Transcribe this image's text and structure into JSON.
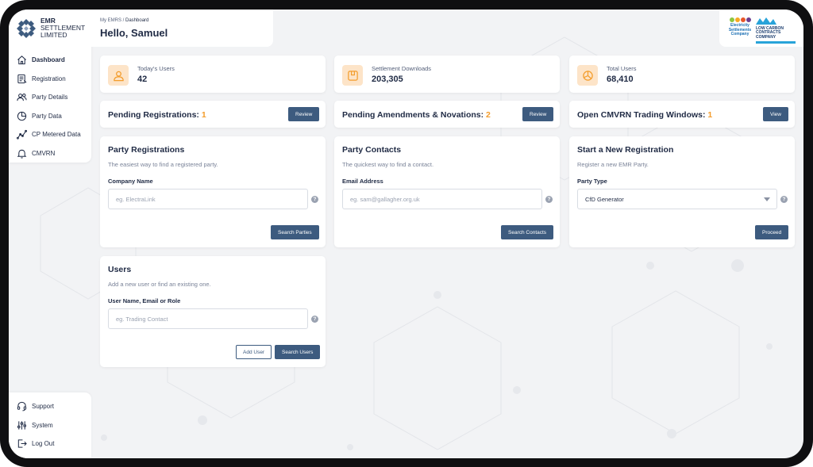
{
  "brand": {
    "line1": "EMR",
    "line2": "SETTLEMENT",
    "line3": "LIMITED"
  },
  "sidebar": {
    "items": [
      {
        "label": "Dashboard",
        "icon": "home-icon"
      },
      {
        "label": "Registration",
        "icon": "form-icon"
      },
      {
        "label": "Party Details",
        "icon": "users-icon"
      },
      {
        "label": "Party Data",
        "icon": "pie-icon"
      },
      {
        "label": "CP Metered Data",
        "icon": "chart-line-icon"
      },
      {
        "label": "CMVRN",
        "icon": "bell-icon"
      }
    ],
    "bottom_items": [
      {
        "label": "Support",
        "icon": "headset-icon"
      },
      {
        "label": "System",
        "icon": "sliders-icon"
      },
      {
        "label": "Log Out",
        "icon": "logout-icon"
      }
    ]
  },
  "header": {
    "crumb_root": "My EMRS",
    "crumb_sep": " / ",
    "crumb_current": "Dashboard",
    "greeting": "Hello, Samuel"
  },
  "partners": {
    "esc": {
      "line1": "Electricity",
      "line2": "Settlements",
      "line3": "Company"
    },
    "lcc": {
      "line1": "LOW CARBON",
      "line2": "CONTRACTS COMPANY"
    }
  },
  "stats": [
    {
      "label": "Today's Users",
      "value": "42"
    },
    {
      "label": "Settlement Downloads",
      "value": "203,305"
    },
    {
      "label": "Total Users",
      "value": "68,410"
    }
  ],
  "pending": [
    {
      "label": "Pending Registrations: ",
      "count": "1",
      "button": "Review"
    },
    {
      "label": "Pending Amendments & Novations: ",
      "count": "2",
      "button": "Review"
    },
    {
      "label": "Open CMVRN Trading Windows: ",
      "count": "1",
      "button": "View"
    }
  ],
  "party_registrations": {
    "title": "Party Registrations",
    "subtitle": "The easiest way to find a registered party.",
    "field_label": "Company Name",
    "placeholder": "eg. ElectraLink",
    "button": "Search Parties"
  },
  "party_contacts": {
    "title": "Party Contacts",
    "subtitle": "The quickest way to find a contact.",
    "field_label": "Email Address",
    "placeholder": "eg. sam@gallagher.org.uk",
    "button": "Search Contacts"
  },
  "new_registration": {
    "title": "Start a New Registration",
    "subtitle": "Register a new EMR Party.",
    "field_label": "Party Type",
    "selected": "CfD Generator",
    "button": "Proceed"
  },
  "users": {
    "title": "Users",
    "subtitle": "Add a new user or find an existing one.",
    "field_label": "User Name, Email or Role",
    "placeholder": "eg. Trading Contact",
    "add_button": "Add User",
    "search_button": "Search Users"
  },
  "help_glyph": "?",
  "colors": {
    "accent_orange": "#f39c2b",
    "button_blue": "#3d5b7f",
    "icon_bg": "#fde4c8"
  }
}
